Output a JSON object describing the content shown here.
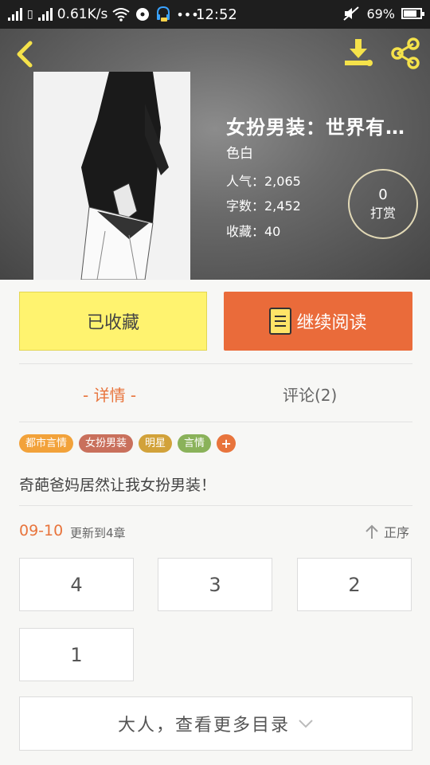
{
  "status_bar": {
    "speed": "0.61K/s",
    "time": "12:52",
    "battery": "69%"
  },
  "book": {
    "title": "女扮男装：世界有…",
    "author": "色白",
    "popularity": "人气：2,065",
    "word_count": "字数：2,452",
    "favorites": "收藏：40",
    "reward_count": "0",
    "reward_label": "打赏"
  },
  "actions": {
    "collected_label": "已收藏",
    "continue_label": "继续阅读"
  },
  "tabs": {
    "details": "- 详情 -",
    "comments": "评论(2)"
  },
  "tags": [
    {
      "label": "都市言情",
      "color": "#f2a23a"
    },
    {
      "label": "女扮男装",
      "color": "#c9705c"
    },
    {
      "label": "明星",
      "color": "#d2a23a"
    },
    {
      "label": "言情",
      "color": "#8ab25a"
    },
    {
      "label": "+",
      "color": "#e8743c"
    }
  ],
  "description": "奇葩爸妈居然让我女扮男装！",
  "update": {
    "date": "09-10",
    "text": "更新到4章",
    "sort_label": "正序"
  },
  "chapters": [
    "4",
    "3",
    "2",
    "1"
  ],
  "more_label": "大人，查看更多目录",
  "colors": {
    "accent": "#e8743c",
    "collected_bg": "#fff36f",
    "read_bg": "#ea6b3a"
  }
}
